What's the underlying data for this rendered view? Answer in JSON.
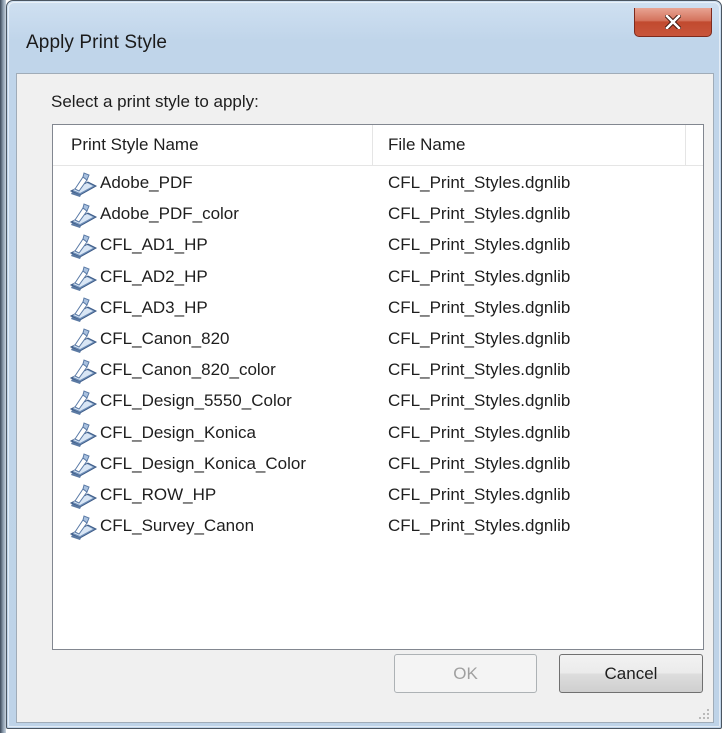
{
  "window": {
    "title": "Apply Print Style"
  },
  "dialog": {
    "prompt": "Select a print style to apply:",
    "columns": {
      "name": "Print Style Name",
      "file": "File Name"
    },
    "rows": [
      {
        "name": "Adobe_PDF",
        "file": "CFL_Print_Styles.dgnlib"
      },
      {
        "name": "Adobe_PDF_color",
        "file": "CFL_Print_Styles.dgnlib"
      },
      {
        "name": "CFL_AD1_HP",
        "file": "CFL_Print_Styles.dgnlib"
      },
      {
        "name": "CFL_AD2_HP",
        "file": "CFL_Print_Styles.dgnlib"
      },
      {
        "name": "CFL_AD3_HP",
        "file": "CFL_Print_Styles.dgnlib"
      },
      {
        "name": "CFL_Canon_820",
        "file": "CFL_Print_Styles.dgnlib"
      },
      {
        "name": "CFL_Canon_820_color",
        "file": "CFL_Print_Styles.dgnlib"
      },
      {
        "name": "CFL_Design_5550_Color",
        "file": "CFL_Print_Styles.dgnlib"
      },
      {
        "name": "CFL_Design_Konica",
        "file": "CFL_Print_Styles.dgnlib"
      },
      {
        "name": "CFL_Design_Konica_Color",
        "file": "CFL_Print_Styles.dgnlib"
      },
      {
        "name": "CFL_ROW_HP",
        "file": "CFL_Print_Styles.dgnlib"
      },
      {
        "name": "CFL_Survey_Canon",
        "file": "CFL_Print_Styles.dgnlib"
      }
    ],
    "row_icon": "print-style-icon",
    "buttons": {
      "ok": {
        "label": "OK",
        "enabled": false
      },
      "cancel": {
        "label": "Cancel",
        "enabled": true
      }
    }
  },
  "colors": {
    "close_button": "#c8553b",
    "title_bar": "#c0d5ea",
    "client_bg": "#f0f0f0",
    "disabled_text": "#a0a0a0"
  }
}
